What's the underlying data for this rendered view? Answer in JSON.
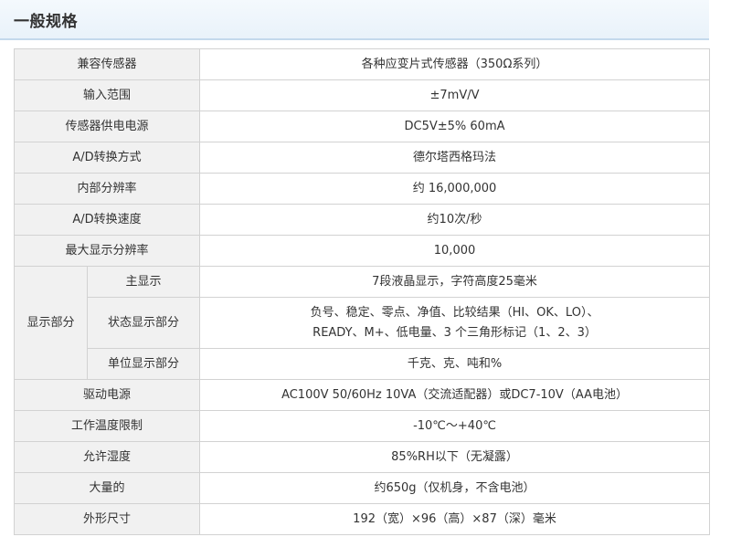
{
  "header": {
    "title": "一般规格"
  },
  "rows": [
    {
      "label": "兼容传感器",
      "value": "各种应变片式传感器（350Ω系列）"
    },
    {
      "label": "输入范围",
      "value": "±7mV/V"
    },
    {
      "label": "传感器供电电源",
      "value": "DC5V±5% 60mA"
    },
    {
      "label": "A/D转换方式",
      "value": "德尔塔西格玛法"
    },
    {
      "label": "内部分辨率",
      "value": "约 16,000,000"
    },
    {
      "label": "A/D转换速度",
      "value": "约10次/秒"
    },
    {
      "label": "最大显示分辨率",
      "value": "10,000"
    }
  ],
  "display": {
    "label": "显示部分",
    "main": {
      "label": "主显示",
      "value": "7段液晶显示，字符高度25毫米"
    },
    "status": {
      "label": "状态显示部分",
      "value_line1": "负号、稳定、零点、净值、比较结果（HI、OK、LO）、",
      "value_line2": "READY、M+、低电量、3 个三角形标记（1、2、3）"
    },
    "unit": {
      "label": "单位显示部分",
      "value": "千克、克、吨和%"
    }
  },
  "rows2": [
    {
      "label": "驱动电源",
      "value": "AC100V 50/60Hz 10VA（交流适配器）或DC7-10V（AA电池）"
    },
    {
      "label": "工作温度限制",
      "value": "-10℃～+40℃"
    },
    {
      "label": "允许湿度",
      "value": "85%RH以下（无凝露）"
    },
    {
      "label": "大量的",
      "value": "约650g（仅机身，不含电池）"
    },
    {
      "label": "外形尺寸",
      "value": "192（宽）×96（高）×87（深）毫米"
    }
  ]
}
